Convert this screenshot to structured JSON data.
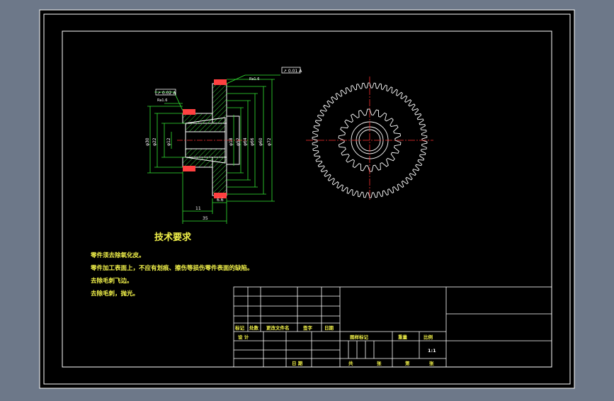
{
  "colors": {
    "background": "#6d7889",
    "sheet": "#000000",
    "frame": "#ffffff",
    "geometry": "#ffffff",
    "dimensions": "#33e633",
    "centerline": "#ff3030",
    "hatch": "#33cc33",
    "text_yellow": "#f2f24a",
    "text_green": "#3ff23f"
  },
  "section_view": {
    "dims": {
      "h1": "35",
      "h2": "11",
      "h3": "6.6",
      "v1": "φ30",
      "v2": "φ22",
      "v3": "φ12",
      "v4": "φ18",
      "v5": "φ52",
      "v6": "φ64",
      "v7": "φ66",
      "v8": "φ60",
      "v9": "φ72"
    },
    "roughness": "Ra1.6",
    "callouts": [
      "↗ 0.01 A",
      "↗ 0.02 A"
    ]
  },
  "gear_view": {
    "outer_teeth": 62,
    "inner_teeth": 22
  },
  "notes": {
    "title": "技术要求",
    "lines": [
      "零件须去除氧化皮。",
      "零件加工表面上，不应有划痕、擦伤等损伤零件表面的缺陷。",
      "去除毛刺飞边。",
      "去除毛刺，抛光。"
    ]
  },
  "title_block": {
    "header_labels": [
      "标记",
      "处数",
      "更改文件名",
      "签字",
      "日期"
    ],
    "design_label": "设 计",
    "date_label": "日 期",
    "stage_labels": [
      "图样标记",
      "重量",
      "比例"
    ],
    "scale": "1:1",
    "sheet_labels": [
      "共",
      "张",
      "第",
      "张"
    ]
  }
}
